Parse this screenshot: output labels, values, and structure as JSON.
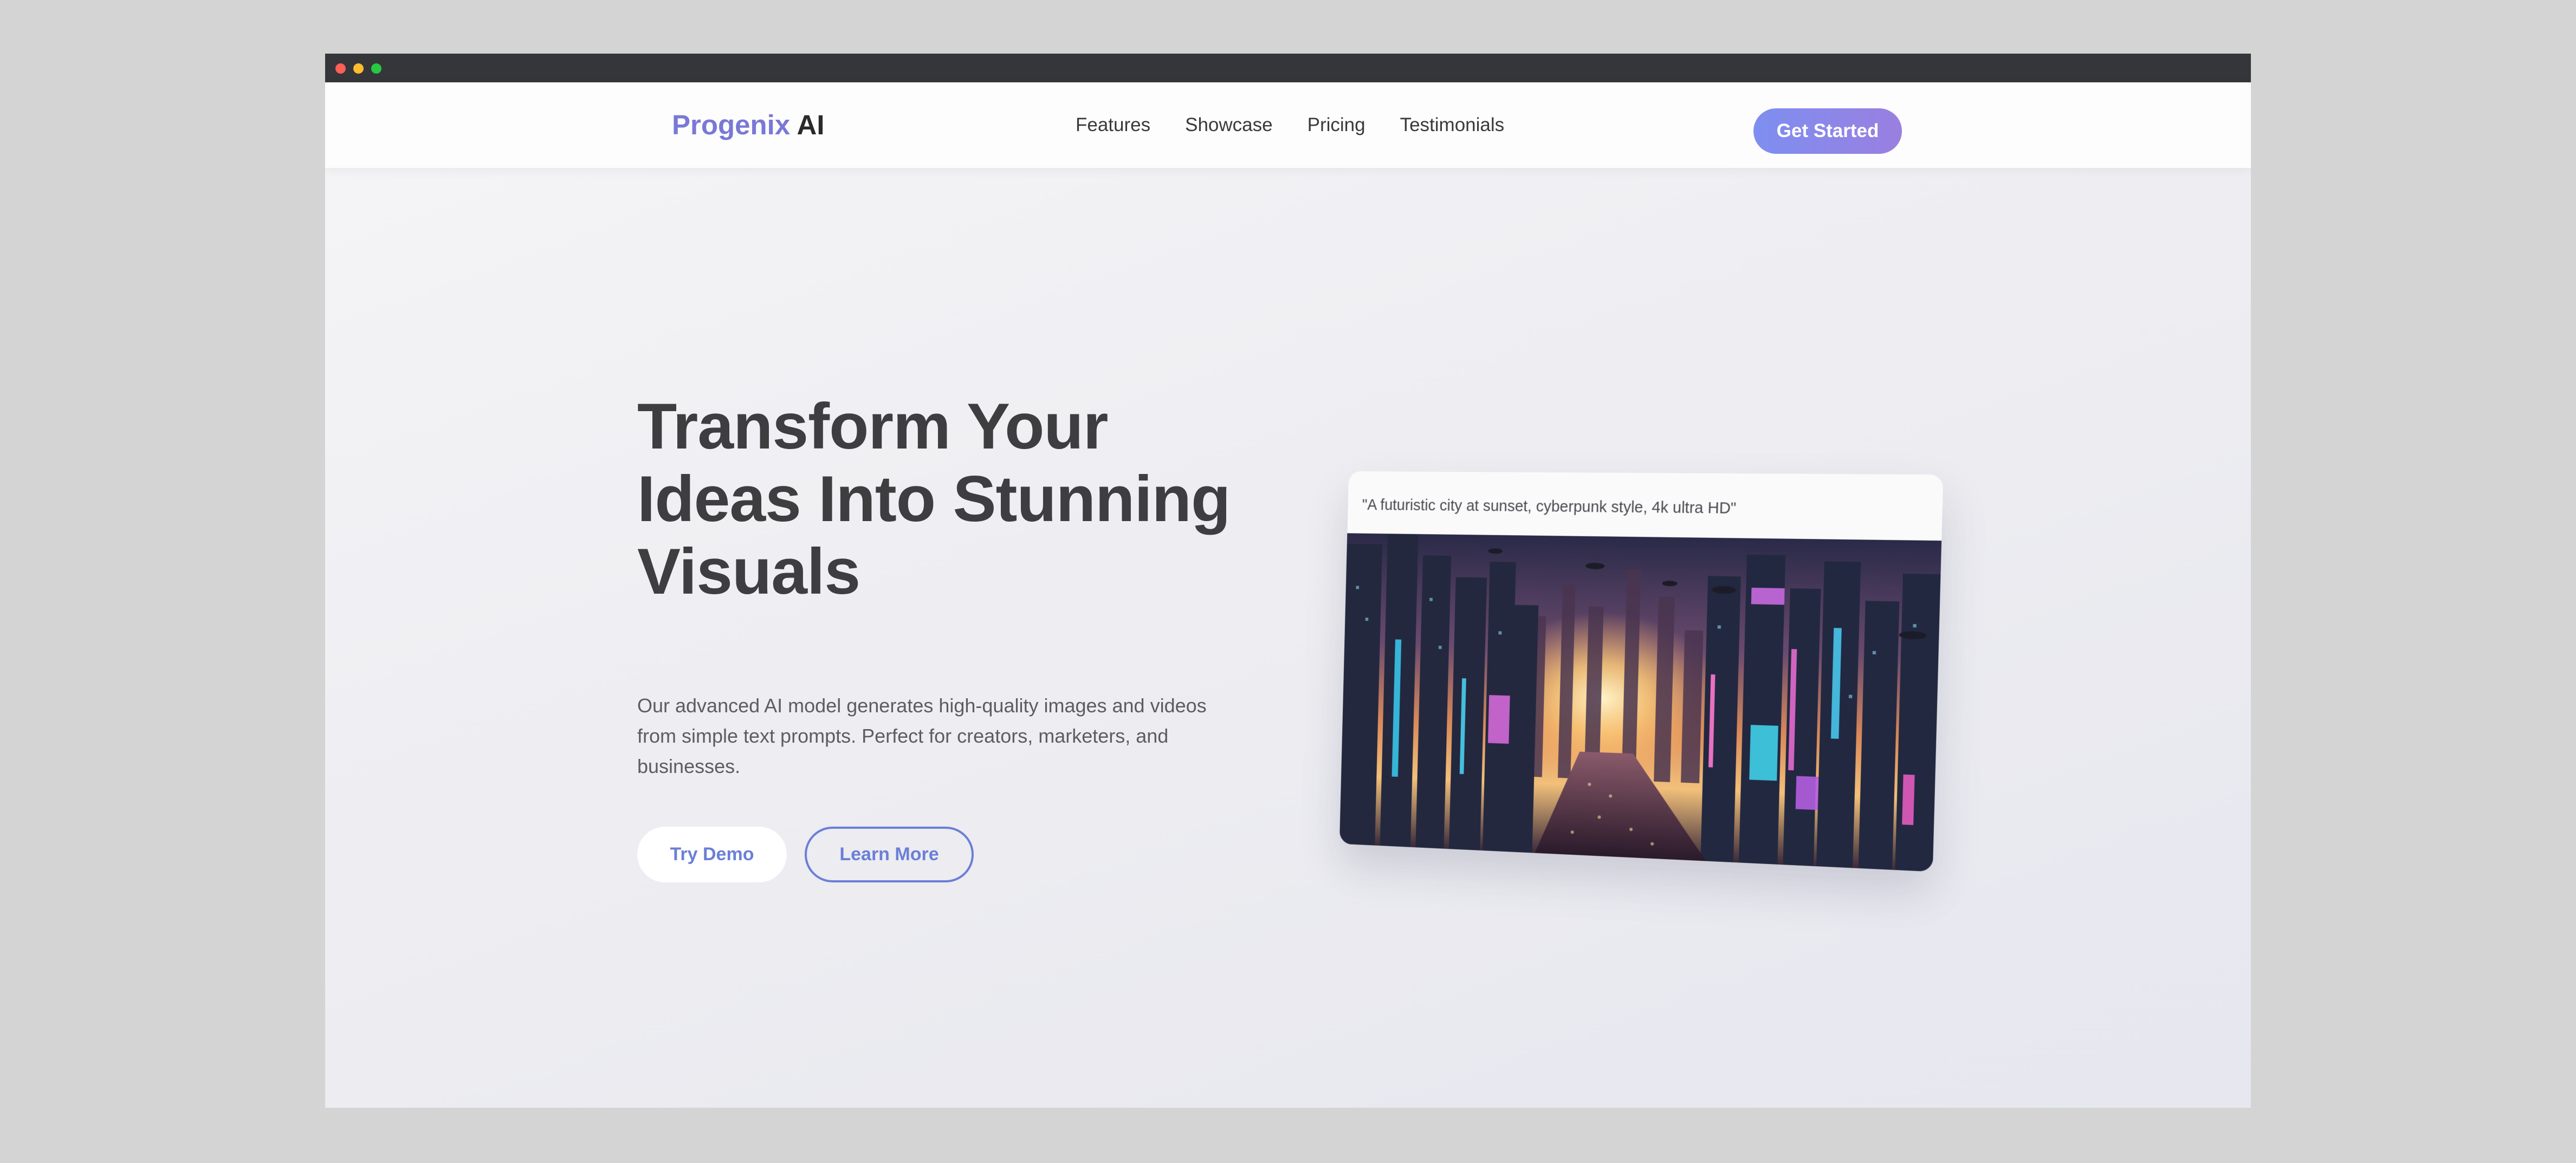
{
  "navbar": {
    "logo_brand": "Progenix",
    "logo_suffix": "AI",
    "links": [
      "Features",
      "Showcase",
      "Pricing",
      "Testimonials"
    ],
    "cta_label": "Get Started"
  },
  "hero": {
    "title": "Transform Your Ideas Into Stunning Visuals",
    "description": "Our advanced AI model generates high-quality images and videos from simple text prompts. Perfect for creators, marketers, and businesses.",
    "primary_button": "Try Demo",
    "secondary_button": "Learn More"
  },
  "demo_card": {
    "prompt": "\"A futuristic city at sunset, cyberpunk style, 4k ultra HD\"",
    "image_description": "cyberpunk-city-sunset"
  },
  "colors": {
    "accent": "#7a78d6",
    "button_text": "#6b7fd6",
    "cta_gradient_start": "#7d8ff0",
    "cta_gradient_end": "#9a7fe0",
    "title_text": "#3e3e40"
  }
}
